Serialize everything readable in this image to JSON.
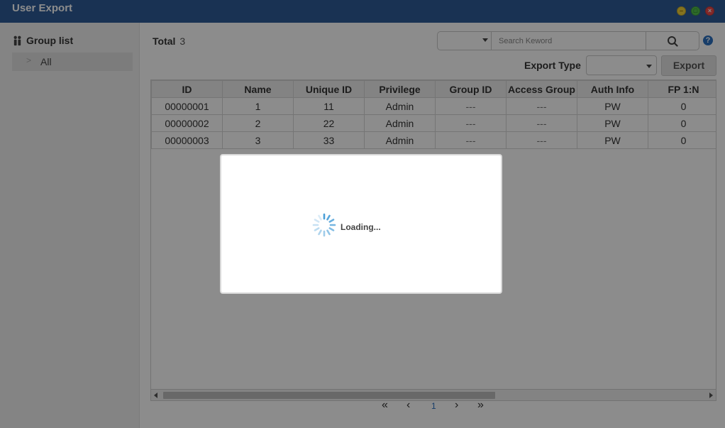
{
  "window": {
    "title": "User Export",
    "buttons": {
      "minimize": "–",
      "maximize": "□",
      "close": "×"
    }
  },
  "sidebar": {
    "header": "Group list",
    "items": [
      {
        "label": "All"
      }
    ]
  },
  "toolbar": {
    "total_label": "Total",
    "total_count": "3",
    "search_placeholder": "Search Keword",
    "search_field_value": "",
    "export_type_label": "Export Type",
    "export_type_value": "",
    "export_button": "Export",
    "help": "?"
  },
  "table": {
    "columns": [
      "ID",
      "Name",
      "Unique ID",
      "Privilege",
      "Group ID",
      "Access Group",
      "Auth Info",
      "FP 1:N"
    ],
    "rows": [
      [
        "00000001",
        "1",
        "11",
        "Admin",
        "---",
        "---",
        "PW",
        "0"
      ],
      [
        "00000002",
        "2",
        "22",
        "Admin",
        "---",
        "---",
        "PW",
        "0"
      ],
      [
        "00000003",
        "3",
        "33",
        "Admin",
        "---",
        "---",
        "PW",
        "0"
      ]
    ]
  },
  "pagination": {
    "first": "«",
    "prev": "‹",
    "current_page": "1",
    "next": "›",
    "last": "»"
  },
  "modal": {
    "loading_text": "Loading..."
  },
  "colors": {
    "titlebar": "#2e5c98",
    "overlay": "rgba(0,0,0,0.45)",
    "accent": "#2a6fc0",
    "spinner": "#4a9fd8"
  }
}
